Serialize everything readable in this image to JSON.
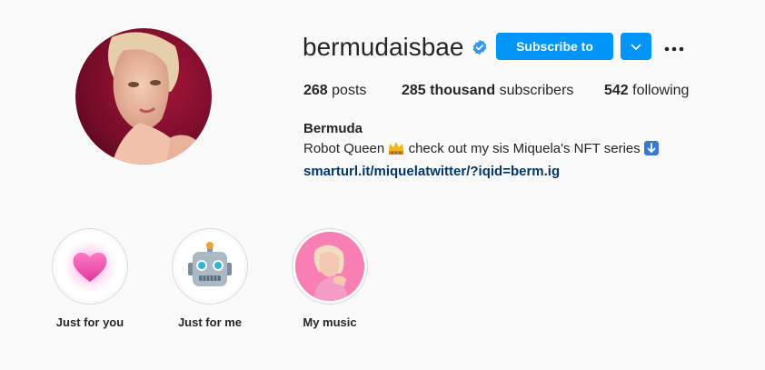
{
  "profile": {
    "username": "bermudaisbae",
    "verified": true,
    "subscribe_label": "Subscribe to",
    "stats": {
      "posts_count": "268",
      "posts_label": "posts",
      "subscribers_count": "285 thousand",
      "subscribers_label": "subscribers",
      "following_count": "542",
      "following_label": "following"
    },
    "bio": {
      "name": "Bermuda",
      "text_before": "Robot Queen",
      "text_after": "check out my sis Miquela's NFT series",
      "link": "smarturl.it/miquelatwitter/?iqid=berm.ig"
    }
  },
  "highlights": [
    {
      "label": "Just for you",
      "icon": "pink-heart-icon"
    },
    {
      "label": "Just for me",
      "icon": "robot-face-icon"
    },
    {
      "label": "My music",
      "icon": "music-cover-photo"
    }
  ],
  "colors": {
    "accent": "#0095f6",
    "link": "#00376b",
    "text": "#262626",
    "background": "#fafafa"
  }
}
